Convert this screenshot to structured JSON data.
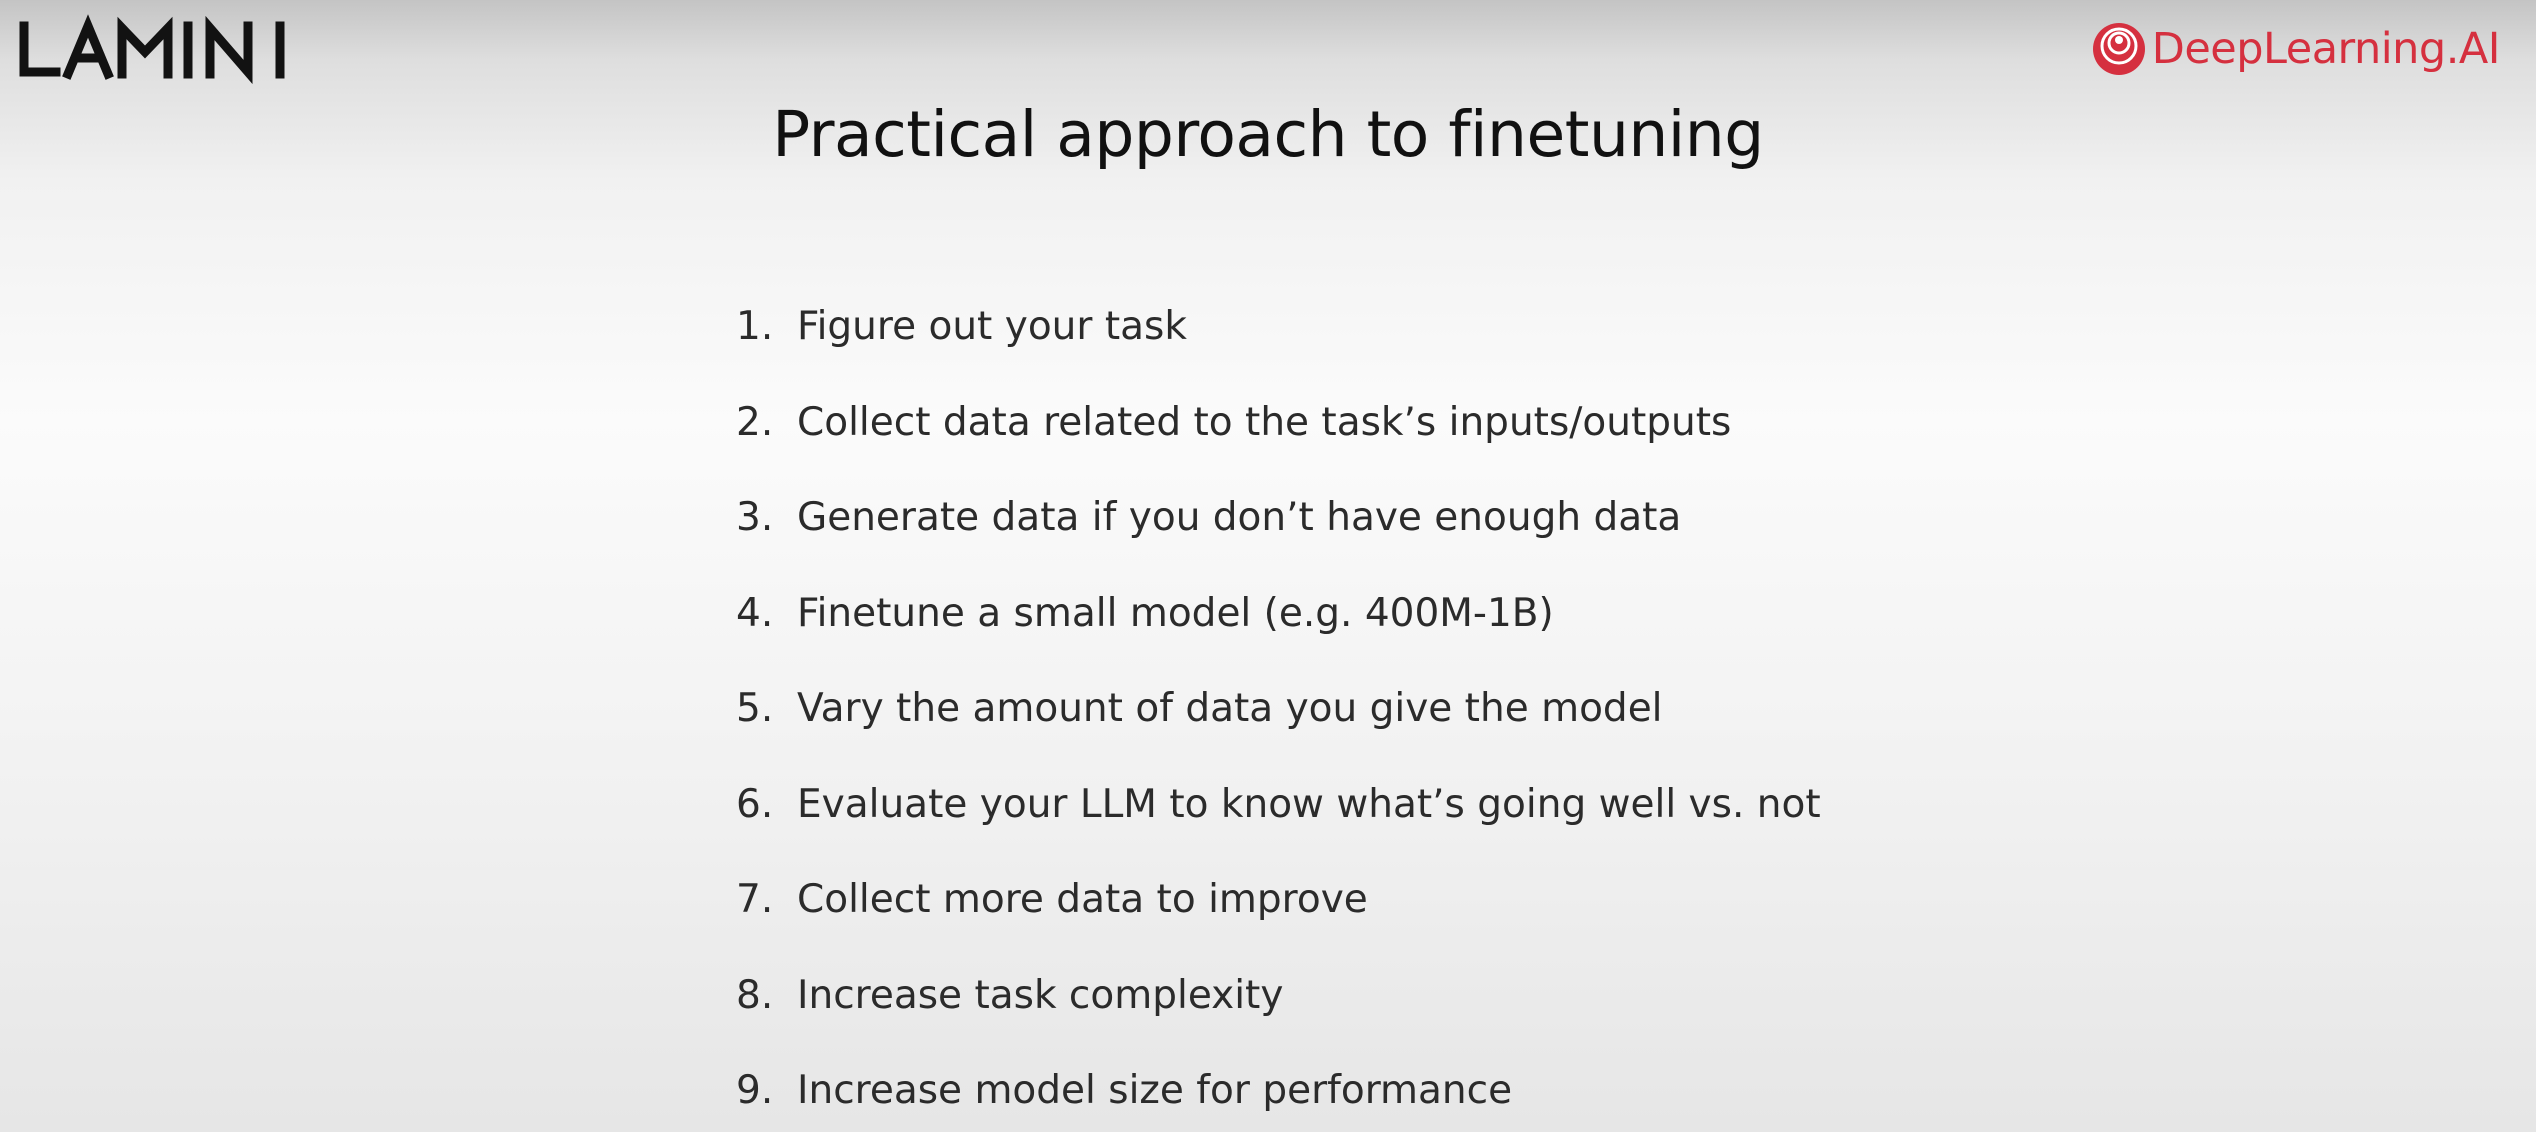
{
  "header": {
    "left_logo_text": "LAMINI",
    "right_logo_text": "DeepLearning.AI",
    "brand_color": "#d5303f",
    "right_logo_icon": "deeplearning-ai-logo-icon"
  },
  "title": "Practical approach to finetuning",
  "steps": [
    {
      "num": "1.",
      "text": "Figure out your task"
    },
    {
      "num": "2.",
      "text": "Collect data related to the task’s inputs/outputs"
    },
    {
      "num": "3.",
      "text": "Generate data if you don’t have enough data"
    },
    {
      "num": "4.",
      "text": "Finetune a small model (e.g. 400M-1B)"
    },
    {
      "num": "5.",
      "text": "Vary the amount of data you give the model"
    },
    {
      "num": "6.",
      "text": "Evaluate your LLM to know what’s going well vs. not"
    },
    {
      "num": "7.",
      "text": "Collect more data to improve"
    },
    {
      "num": "8.",
      "text": "Increase task complexity"
    },
    {
      "num": "9.",
      "text": "Increase model size for performance"
    }
  ]
}
